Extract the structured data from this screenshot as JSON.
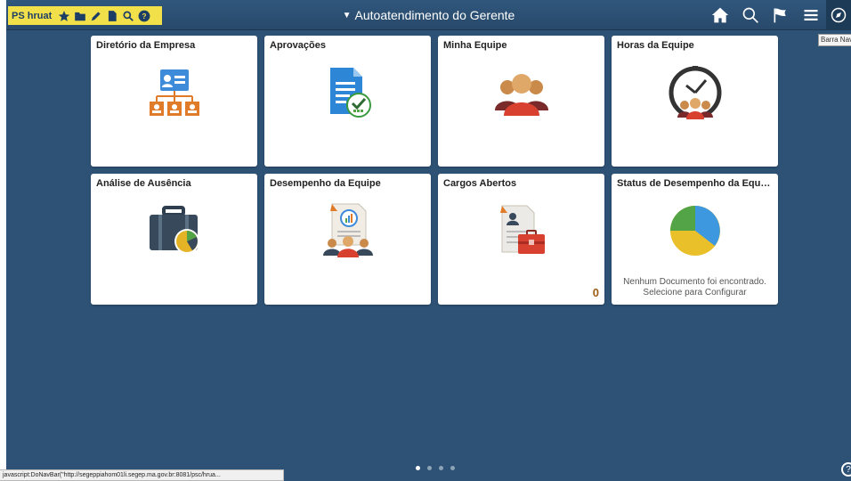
{
  "toolbar": {
    "label": "PS hruat",
    "icons": [
      "star-icon",
      "folder-icon",
      "pencil-icon",
      "document-icon",
      "search-icon",
      "help-icon"
    ]
  },
  "header": {
    "title": "Autoatendimento do Gerente",
    "nav_icons": [
      "home-icon",
      "search-icon",
      "flag-icon",
      "menu-icon",
      "navbar-icon"
    ],
    "tooltip": "Barra Navegação"
  },
  "tiles": [
    {
      "title": "Diretório da Empresa",
      "icon": "org-directory-icon"
    },
    {
      "title": "Aprovações",
      "icon": "approval-document-icon"
    },
    {
      "title": "Minha Equipe",
      "icon": "team-icon"
    },
    {
      "title": "Horas da Equipe",
      "icon": "team-clock-icon"
    },
    {
      "title": "Análise de Ausência",
      "icon": "briefcase-chart-icon"
    },
    {
      "title": "Desempenho da Equipe",
      "icon": "team-performance-icon"
    },
    {
      "title": "Cargos Abertos",
      "icon": "open-positions-icon",
      "count": "0"
    },
    {
      "title": "Status de Desempenho da Equi…",
      "icon": "pie-chart-icon",
      "message_line1": "Nenhum Documento foi encontrado.",
      "message_line2": "Selecione para Configurar"
    }
  ],
  "pagination": {
    "pages": 4,
    "active": 1
  },
  "status_bar": {
    "text": "javascript:DoNavBar(\"http://segeppiahom01li.segep.ma.gov.br:8081/psc/hrua..."
  },
  "colors": {
    "background": "#2e5275",
    "toolbar": "#f2e04b",
    "accent_orange": "#e07b2a",
    "accent_blue": "#3d8bd9",
    "accent_green": "#52a447",
    "accent_red": "#c83a2e"
  }
}
